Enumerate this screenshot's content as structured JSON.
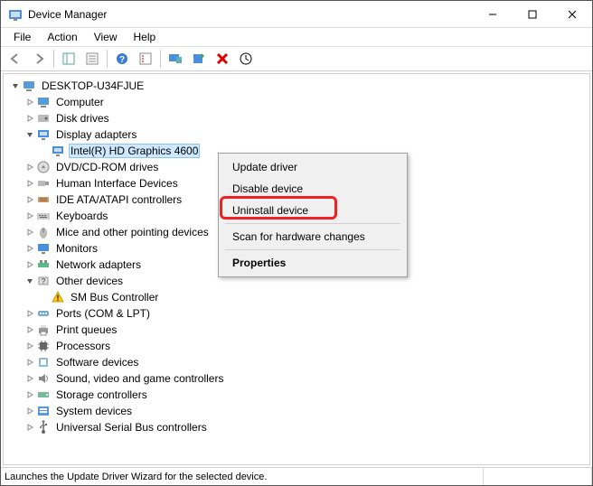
{
  "window": {
    "title": "Device Manager"
  },
  "menubar": [
    "File",
    "Action",
    "View",
    "Help"
  ],
  "toolbar_icons": [
    "back",
    "forward",
    "show-hide-tree",
    "properties",
    "help",
    "scan",
    "monitor-ext",
    "update-driver",
    "uninstall",
    "stop"
  ],
  "tree": {
    "root": "DESKTOP-U34FJUE",
    "items": [
      {
        "label": "Computer",
        "icon": "computer",
        "expanded": false
      },
      {
        "label": "Disk drives",
        "icon": "disk",
        "expanded": false
      },
      {
        "label": "Display adapters",
        "icon": "display",
        "expanded": true,
        "children": [
          {
            "label": "Intel(R) HD Graphics 4600",
            "icon": "display",
            "selected": true
          }
        ]
      },
      {
        "label": "DVD/CD-ROM drives",
        "icon": "dvd",
        "expanded": false
      },
      {
        "label": "Human Interface Devices",
        "icon": "hid",
        "expanded": false
      },
      {
        "label": "IDE ATA/ATAPI controllers",
        "icon": "ide",
        "expanded": false
      },
      {
        "label": "Keyboards",
        "icon": "keyboard",
        "expanded": false
      },
      {
        "label": "Mice and other pointing devices",
        "icon": "mouse",
        "expanded": false
      },
      {
        "label": "Monitors",
        "icon": "monitor",
        "expanded": false
      },
      {
        "label": "Network adapters",
        "icon": "network",
        "expanded": false
      },
      {
        "label": "Other devices",
        "icon": "other",
        "expanded": true,
        "children": [
          {
            "label": "SM Bus Controller",
            "icon": "warning"
          }
        ]
      },
      {
        "label": "Ports (COM & LPT)",
        "icon": "ports",
        "expanded": false
      },
      {
        "label": "Print queues",
        "icon": "printer",
        "expanded": false
      },
      {
        "label": "Processors",
        "icon": "cpu",
        "expanded": false
      },
      {
        "label": "Software devices",
        "icon": "software",
        "expanded": false
      },
      {
        "label": "Sound, video and game controllers",
        "icon": "sound",
        "expanded": false
      },
      {
        "label": "Storage controllers",
        "icon": "storage",
        "expanded": false
      },
      {
        "label": "System devices",
        "icon": "system",
        "expanded": false
      },
      {
        "label": "Universal Serial Bus controllers",
        "icon": "usb",
        "expanded": false
      }
    ]
  },
  "context_menu": {
    "items": [
      {
        "label": "Update driver",
        "type": "normal"
      },
      {
        "label": "Disable device",
        "type": "normal"
      },
      {
        "label": "Uninstall device",
        "type": "normal",
        "highlighted": true
      },
      {
        "type": "sep"
      },
      {
        "label": "Scan for hardware changes",
        "type": "normal"
      },
      {
        "type": "sep"
      },
      {
        "label": "Properties",
        "type": "bold"
      }
    ]
  },
  "statusbar": {
    "text": "Launches the Update Driver Wizard for the selected device."
  }
}
